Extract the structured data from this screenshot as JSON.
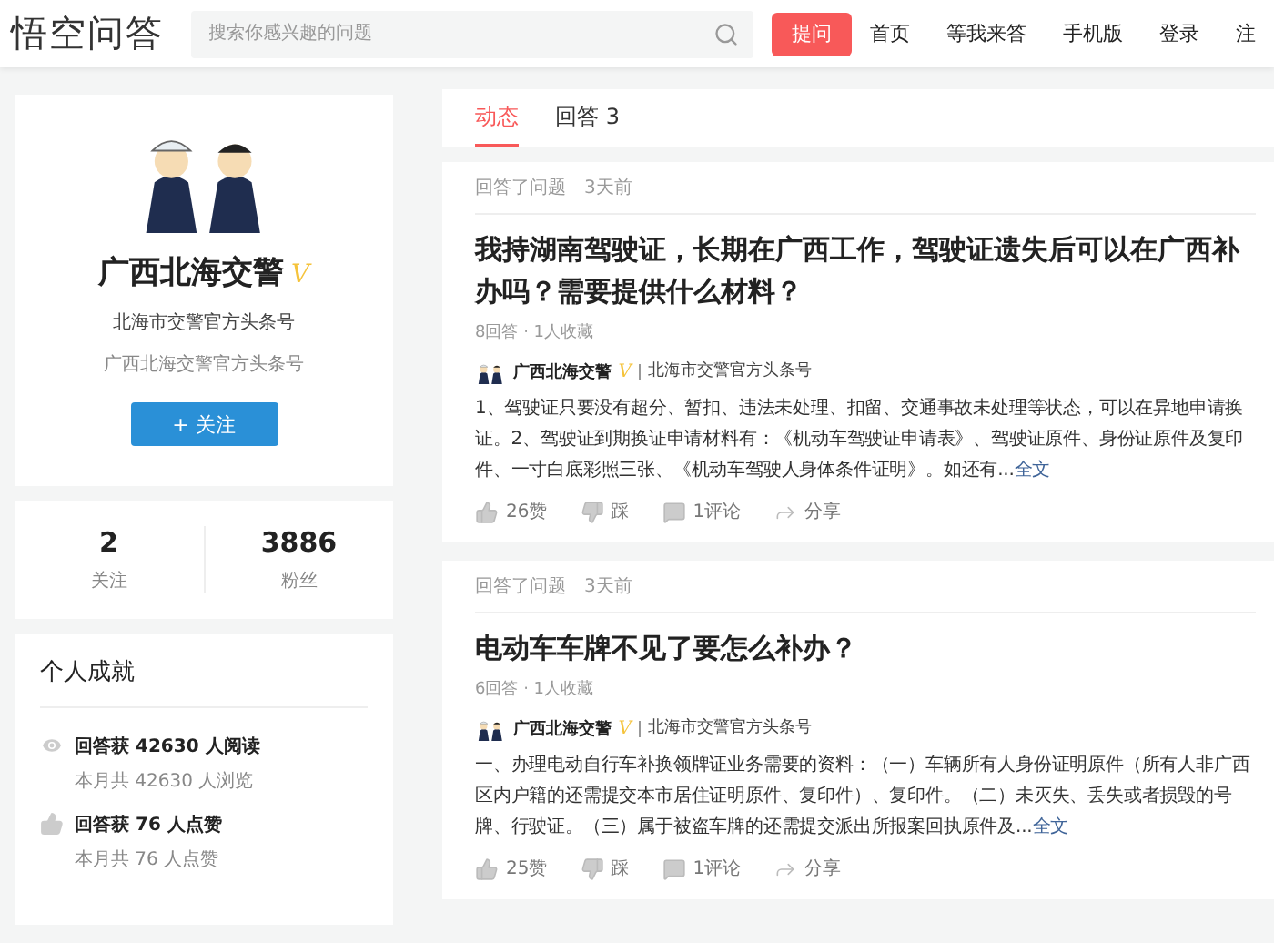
{
  "header": {
    "logo": "悟空问答",
    "search": {
      "placeholder": "搜索你感兴趣的问题"
    },
    "ask_button": "提问",
    "nav": [
      {
        "label": "首页"
      },
      {
        "label": "等我来答"
      },
      {
        "label": "手机版"
      },
      {
        "label": "登录"
      },
      {
        "label": "注"
      }
    ]
  },
  "profile": {
    "name": "广西北海交警",
    "verified": true,
    "verified_mark": "V",
    "subtitle": "北海市交警官方头条号",
    "description": "广西北海交警官方头条号",
    "follow_button": "+ 关注"
  },
  "stats": [
    {
      "value": "2",
      "label": "关注"
    },
    {
      "value": "3886",
      "label": "粉丝"
    }
  ],
  "achievements": {
    "title": "个人成就",
    "items": [
      {
        "kind": "read",
        "headline": "回答获 42630 人阅读",
        "detail": "本月共 42630 人浏览"
      },
      {
        "kind": "like",
        "headline": "回答获 76 人点赞",
        "detail": "本月共 76 人点赞"
      }
    ]
  },
  "tabs": [
    {
      "label": "动态",
      "selected": true
    },
    {
      "label": "回答 3",
      "selected": false
    }
  ],
  "feed": [
    {
      "action": "回答了问题",
      "time": "3天前",
      "title": "我持湖南驾驶证，长期在广西工作，驾驶证遗失后可以在广西补办吗？需要提供什么材料？",
      "meta": "8回答 · 1人收藏",
      "author": {
        "name": "广西北海交警",
        "verified": true,
        "verified_mark": "V",
        "description": "北海市交警官方头条号"
      },
      "body": "1、驾驶证只要没有超分、暂扣、违法未处理、扣留、交通事故未处理等状态，可以在异地申请换证。2、驾驶证到期换证申请材料有：《机动车驾驶证申请表》、驾驶证原件、身份证原件及复印件、一寸白底彩照三张、《机动车驾驶人身体条件证明》。如还有...",
      "more": "全文",
      "likes": "26赞",
      "dislike": "踩",
      "comments": "1评论",
      "share": "分享"
    },
    {
      "action": "回答了问题",
      "time": "3天前",
      "title": "电动车车牌不见了要怎么补办？",
      "meta": "6回答 · 1人收藏",
      "author": {
        "name": "广西北海交警",
        "verified": true,
        "verified_mark": "V",
        "description": "北海市交警官方头条号"
      },
      "body": "一、办理电动自行车补换领牌证业务需要的资料：（一）车辆所有人身份证明原件（所有人非广西区内户籍的还需提交本市居住证明原件、复印件）、复印件。（二）未灭失、丢失或者损毁的号牌、行驶证。（三）属于被盗车牌的还需提交派出所报案回执原件及...",
      "more": "全文",
      "likes": "25赞",
      "dislike": "踩",
      "comments": "1评论",
      "share": "分享"
    }
  ]
}
